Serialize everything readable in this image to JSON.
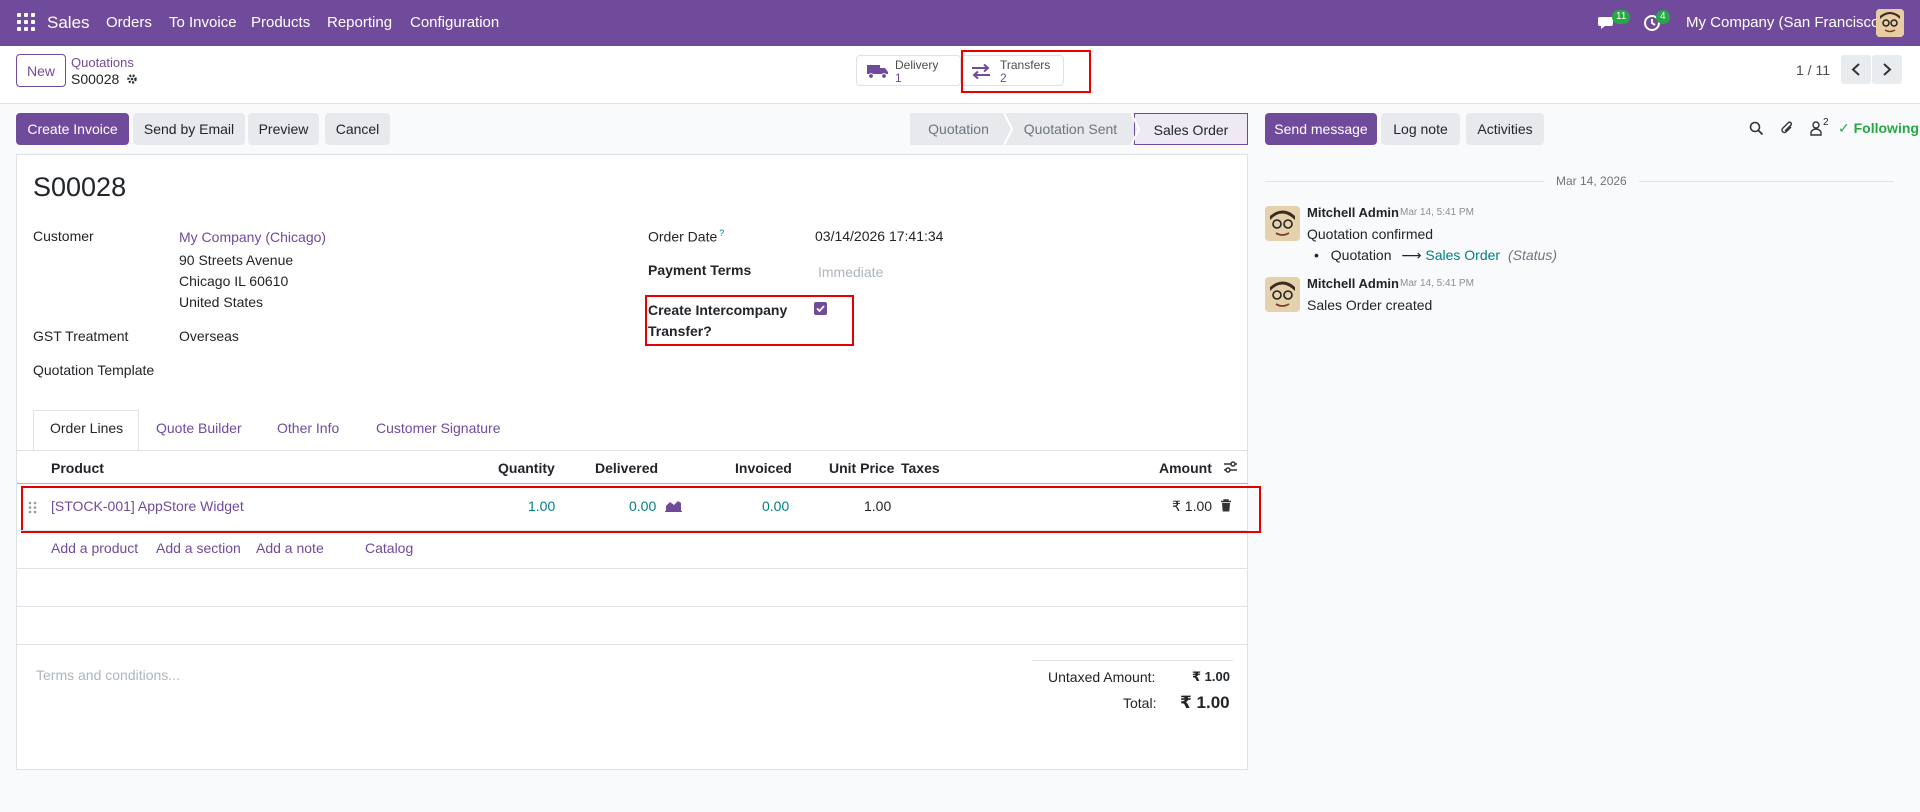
{
  "navbar": {
    "brand": "Sales",
    "menu": [
      "Orders",
      "To Invoice",
      "Products",
      "Reporting",
      "Configuration"
    ],
    "messages_badge": "11",
    "activities_badge": "4",
    "company": "My Company (San Francisco)"
  },
  "control_panel": {
    "new_label": "New",
    "breadcrumb_parent": "Quotations",
    "breadcrumb_current": "S00028",
    "stat_delivery_label": "Delivery",
    "stat_delivery_value": "1",
    "stat_transfers_label": "Transfers",
    "stat_transfers_value": "2",
    "pager": "1 / 11"
  },
  "actions": {
    "create_invoice": "Create Invoice",
    "send_by_email": "Send by Email",
    "preview": "Preview",
    "cancel": "Cancel"
  },
  "statusbar": [
    "Quotation",
    "Quotation Sent",
    "Sales Order"
  ],
  "form": {
    "name": "S00028",
    "customer_label": "Customer",
    "customer_name": "My Company (Chicago)",
    "customer_address_1": "90 Streets Avenue",
    "customer_address_2": "Chicago IL 60610",
    "customer_address_3": "United States",
    "gst_label": "GST Treatment",
    "gst_value": "Overseas",
    "template_label": "Quotation Template",
    "order_date_label": "Order Date",
    "order_date_help": "?",
    "order_date_value": "03/14/2026 17:41:34",
    "payment_terms_label": "Payment Terms",
    "payment_terms_placeholder": "Immediate",
    "intercompany_label_1": "Create Intercompany",
    "intercompany_label_2": "Transfer?",
    "intercompany_checked": true
  },
  "tabs": [
    "Order Lines",
    "Quote Builder",
    "Other Info",
    "Customer Signature"
  ],
  "order_lines": {
    "headers": {
      "product": "Product",
      "quantity": "Quantity",
      "delivered": "Delivered",
      "invoiced": "Invoiced",
      "unit_price": "Unit Price",
      "taxes": "Taxes",
      "amount": "Amount"
    },
    "rows": [
      {
        "product": "[STOCK-001] AppStore Widget",
        "quantity": "1.00",
        "delivered": "0.00",
        "invoiced": "0.00",
        "unit_price": "1.00",
        "taxes": "",
        "amount": "₹ 1.00"
      }
    ],
    "add_product": "Add a product",
    "add_section": "Add a section",
    "add_note": "Add a note",
    "catalog": "Catalog"
  },
  "totals": {
    "terms_placeholder": "Terms and conditions...",
    "untaxed_label": "Untaxed Amount:",
    "untaxed_value": "₹ 1.00",
    "total_label": "Total:",
    "total_value": "₹ 1.00"
  },
  "chatter": {
    "send_message": "Send message",
    "log_note": "Log note",
    "activities": "Activities",
    "followers_count": "2",
    "following": "Following",
    "date_separator": "Mar 14, 2026",
    "messages": [
      {
        "author": "Mitchell Admin",
        "time": "Mar 14, 5:41 PM",
        "body": "Quotation confirmed",
        "change_old": "Quotation",
        "change_arrow": "⟶",
        "change_new": "Sales Order",
        "change_field": "(Status)"
      },
      {
        "author": "Mitchell Admin",
        "time": "Mar 14, 5:41 PM",
        "body": "Sales Order created"
      }
    ]
  },
  "colors": {
    "brand": "#714b9b",
    "link_teal": "#017e84",
    "highlight_red": "#e60000",
    "badge_green": "#28a745"
  }
}
